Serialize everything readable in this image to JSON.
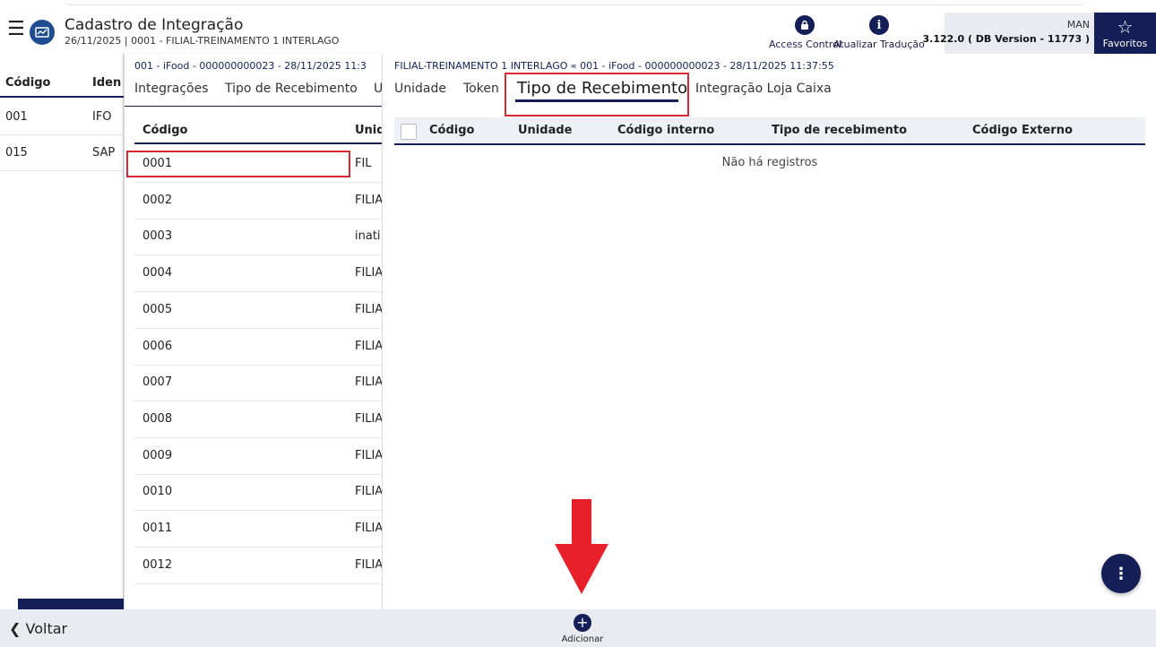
{
  "header": {
    "title": "Cadastro de Integração",
    "subtitle": "26/11/2025 | 0001 - FILIAL-TREINAMENTO 1 INTERLAGO",
    "access_control_label": "Access Control",
    "atualizar_traducao_label": "Atualizar Tradução",
    "user": "MAN",
    "version": "3.122.0 ( DB Version - 11773 )",
    "favoritos_label": "Favoritos",
    "menu_icon": "hamburger-icon",
    "app_icon": "integration-icon"
  },
  "left_panel": {
    "headers": [
      "Código",
      "Iden"
    ],
    "rows": [
      {
        "codigo": "001",
        "ident": "IFO"
      },
      {
        "codigo": "015",
        "ident": "SAP"
      }
    ]
  },
  "middle_panel": {
    "breadcrumb": "001 - iFood - 000000000023 - 28/11/2025 11:3",
    "tabs": [
      "Integrações",
      "Tipo de Recebimento",
      "U"
    ],
    "headers": [
      "Código",
      "Unid"
    ],
    "rows": [
      {
        "codigo": "0001",
        "unidade": "FIL"
      },
      {
        "codigo": "0002",
        "unidade": "FILIA"
      },
      {
        "codigo": "0003",
        "unidade": "inati"
      },
      {
        "codigo": "0004",
        "unidade": "FILIA"
      },
      {
        "codigo": "0005",
        "unidade": "FILIA"
      },
      {
        "codigo": "0006",
        "unidade": "FILIA"
      },
      {
        "codigo": "0007",
        "unidade": "FILIA"
      },
      {
        "codigo": "0008",
        "unidade": "FILIA"
      },
      {
        "codigo": "0009",
        "unidade": "FILIA"
      },
      {
        "codigo": "0010",
        "unidade": "FILIA"
      },
      {
        "codigo": "0011",
        "unidade": "FILIA"
      },
      {
        "codigo": "0012",
        "unidade": "FILIA"
      }
    ]
  },
  "right_panel": {
    "breadcrumb": "FILIAL-TREINAMENTO 1 INTERLAGO  « 001 - iFood - 000000000023 - 28/11/2025 11:37:55",
    "tabs": [
      "Unidade",
      "Token",
      "Tipo de Recebimento",
      "Integração Loja Caixa"
    ],
    "active_tab": "Tipo de Recebimento",
    "headers": [
      "Código",
      "Unidade",
      "Código interno",
      "Tipo de recebimento",
      "Código Externo"
    ],
    "empty_text": "Não há registros"
  },
  "bottom": {
    "back_label": "Voltar",
    "add_label": "Adicionar"
  },
  "colors": {
    "primary": "#141f57",
    "highlight": "#d9282f",
    "arrow": "#e8202a"
  }
}
